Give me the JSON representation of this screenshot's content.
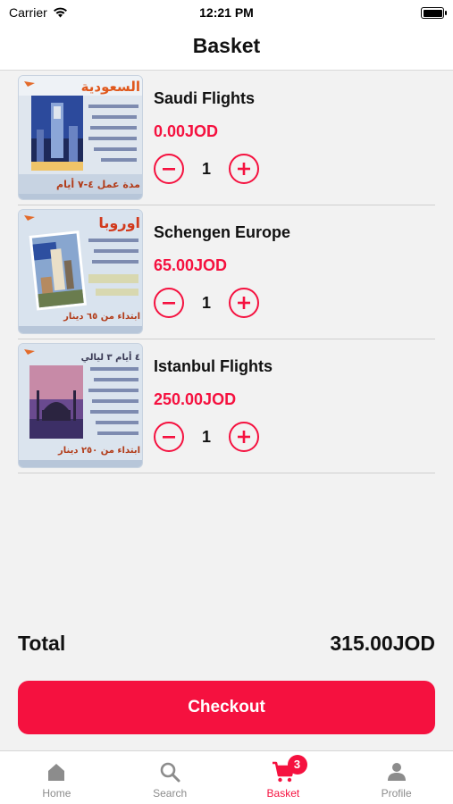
{
  "status_bar": {
    "carrier": "Carrier",
    "time": "12:21 PM"
  },
  "header": {
    "title": "Basket"
  },
  "items": [
    {
      "name": "Saudi Flights",
      "price": "0.00JOD",
      "quantity": "1",
      "thumb": {
        "headline": "السعودية",
        "footer": "مدة عمل ٤-٧ أيام"
      }
    },
    {
      "name": "Schengen Europe",
      "price": "65.00JOD",
      "quantity": "1",
      "thumb": {
        "headline": "اوروبا",
        "footer": "ابتداء من ٦٥ دينار"
      }
    },
    {
      "name": "Istanbul Flights",
      "price": "250.00JOD",
      "quantity": "1",
      "thumb": {
        "headline": "٤ أيام ٣ ليالي",
        "footer": "ابتداء من ٢٥٠ دينار"
      }
    }
  ],
  "summary": {
    "total_label": "Total",
    "total_value": "315.00JOD"
  },
  "checkout_label": "Checkout",
  "tabs": [
    {
      "label": "Home",
      "icon": "home-icon"
    },
    {
      "label": "Search",
      "icon": "search-icon"
    },
    {
      "label": "Basket",
      "icon": "cart-icon",
      "badge": "3",
      "active": true
    },
    {
      "label": "Profile",
      "icon": "profile-icon"
    }
  ],
  "colors": {
    "accent": "#f5113f",
    "tab_inactive": "#8c8c8c",
    "background": "#f2f2f2"
  }
}
